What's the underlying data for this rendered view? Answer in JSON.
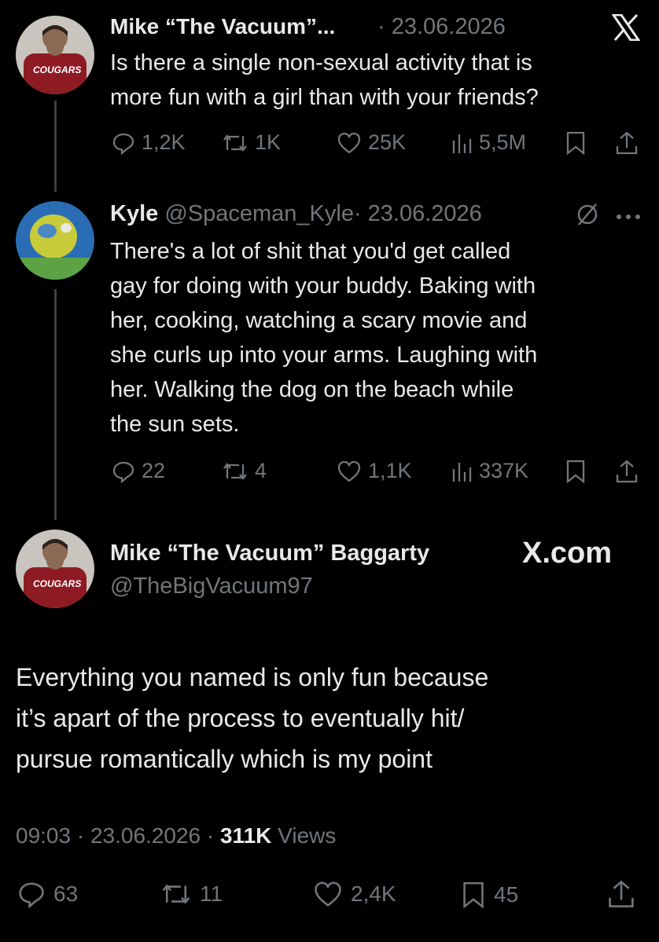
{
  "brand": "X.com",
  "tweet1": {
    "author_name": "Mike “The Vacuum”...",
    "date": "· 23.06.2026",
    "text_line1": "Is there a single non-sexual activity that is",
    "text_line2": "more fun with a girl than with your friends?",
    "metrics": {
      "replies": "1,2K",
      "reposts": "1K",
      "likes": "25K",
      "views": "5,5M"
    },
    "avatar_text": "COUGARS"
  },
  "tweet2": {
    "author_name": "Kyle",
    "handle": "@Spaceman_Kyle",
    "date": "· 23.06.2026",
    "lines": [
      "There's a lot of shit that you'd get called",
      "gay for doing with your buddy. Baking with",
      "her, cooking, watching a scary movie and",
      "she curls up into your arms. Laughing with",
      "her. Walking the dog on the beach while",
      "the sun sets."
    ],
    "metrics": {
      "replies": "22",
      "reposts": "4",
      "likes": "1,1K",
      "views": "337K"
    }
  },
  "tweet3": {
    "author_name": "Mike “The Vacuum” Baggarty",
    "handle": "@TheBigVacuum97",
    "avatar_text": "COUGARS",
    "lines": [
      "Everything you named is only fun because",
      "it’s apart of the process to eventually hit/",
      "pursue romantically which is my point"
    ],
    "time": "09:03",
    "date": "· 23.06.2026 ·",
    "views_count": "311K",
    "views_label": "Views",
    "metrics": {
      "replies": "63",
      "reposts": "11",
      "likes": "2,4K",
      "bookmarks": "45"
    }
  },
  "colors": {
    "background": "#000000",
    "text": "#e7e9ea",
    "muted": "#71767b",
    "thread_line": "#3e4144"
  },
  "icons": [
    "reply-icon",
    "repost-icon",
    "like-icon",
    "views-icon",
    "bookmark-icon",
    "share-icon",
    "x-logo-icon",
    "more-icon",
    "mute-icon"
  ]
}
